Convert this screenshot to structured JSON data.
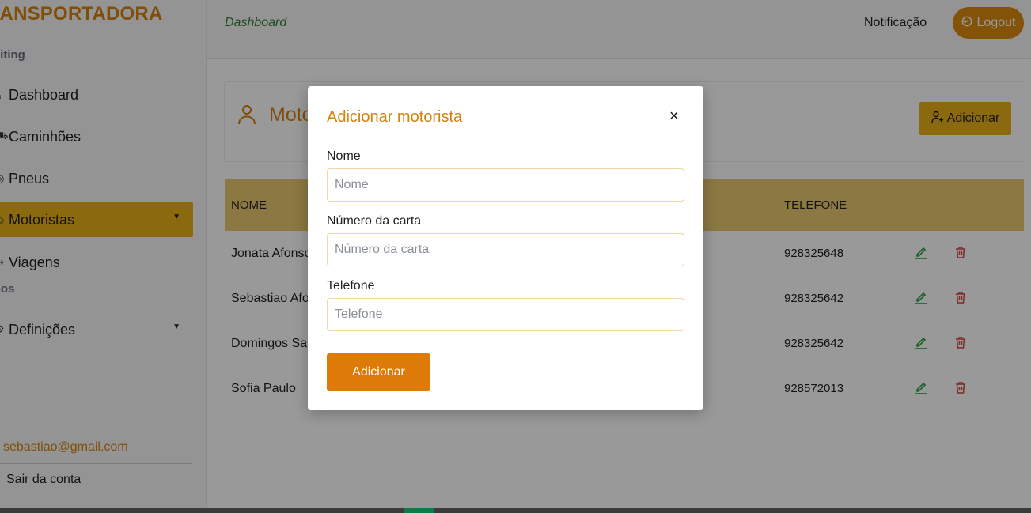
{
  "app": {
    "brand": "RANSPORTADORA"
  },
  "sidebar": {
    "section1": "rkiting",
    "section2": "viços",
    "items": [
      {
        "label": "Dashboard",
        "icon": "home-icon"
      },
      {
        "label": "Caminhões",
        "icon": "truck-icon"
      },
      {
        "label": "Pneus",
        "icon": "tire-icon"
      },
      {
        "label": "Motoristas",
        "icon": "user-icon",
        "active": true,
        "has_caret": true
      },
      {
        "label": "Viagens",
        "icon": "route-icon"
      },
      {
        "label": "Definições",
        "icon": "gear-icon",
        "has_caret": true
      }
    ],
    "user_email": "sebastiao@gmail.com",
    "logout_label": "Sair da conta"
  },
  "topbar": {
    "breadcrumb": "Dashboard",
    "notification": "Notificação",
    "logout": "Logout"
  },
  "main": {
    "title": "Motoristas",
    "add_button": "Adicionar",
    "table": {
      "columns": [
        "NOME",
        "TELEFONE"
      ],
      "rows": [
        {
          "name": "Jonata Afonso",
          "phone": "928325648"
        },
        {
          "name": "Sebastiao Afonso",
          "phone": "928325642"
        },
        {
          "name": "Domingos Santos",
          "phone": "928325642"
        },
        {
          "name": "Sofia Paulo",
          "phone": "928572013"
        }
      ]
    }
  },
  "modal": {
    "title": "Adicionar motorista",
    "close": "×",
    "fields": [
      {
        "label": "Nome",
        "placeholder": "Nome"
      },
      {
        "label": "Número da carta",
        "placeholder": "Número da carta"
      },
      {
        "label": "Telefone",
        "placeholder": "Telefone"
      }
    ],
    "submit": "Adicionar"
  },
  "colors": {
    "brand": "#d4830f",
    "active_nav": "#e8b019",
    "table_header": "#e8c870",
    "submit_button": "#de7a08",
    "edit_icon": "#2e9d46",
    "delete_icon": "#d64545"
  }
}
